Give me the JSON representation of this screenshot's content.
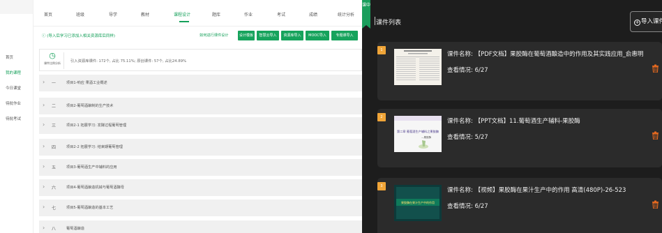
{
  "sidebar": {
    "items": [
      "首页",
      "我的课程",
      "今日课堂",
      "待批作业",
      "待批考试"
    ],
    "active_index": 1
  },
  "nav": {
    "items": [
      "首页",
      "班级",
      "导学",
      "教材",
      "课程设计",
      "题库",
      "作业",
      "考试",
      "成绩",
      "统计分析"
    ],
    "active_index": 4
  },
  "notice": "(导入后学习已添加入相关资源库后同样)",
  "notice_link": "如何进行课件设计",
  "toolbar": {
    "buttons": [
      "设计模板",
      "智慧云导入",
      "资源库导入",
      "MOOC导入",
      "专题课导入"
    ]
  },
  "stats": {
    "icon": "clock-icon",
    "icon_label": "课件比例分析",
    "text": "引入资源库课件: 172个, 占比 75.11%; 原创课件: 57个, 占比24.89%"
  },
  "modules": [
    {
      "num": "一",
      "title": "项目1-响应 果酒工业概述"
    },
    {
      "num": "二",
      "title": "项目2-葡萄酒酿制的生产技术"
    },
    {
      "num": "三",
      "title": "项目2-1 拓展学习: 发酵过程葡萄管理"
    },
    {
      "num": "四",
      "title": "项目2-2 拓展学习: 结束期葡萄管理"
    },
    {
      "num": "五",
      "title": "项目3-葡萄酒生产中辅料的应用"
    },
    {
      "num": "六",
      "title": "项目4-葡萄酒酿造机械与葡萄酒酵母"
    },
    {
      "num": "七",
      "title": "项目5-葡萄酒酿造的基本工艺"
    },
    {
      "num": "八",
      "title": "葡萄酒酿造"
    }
  ],
  "panel": {
    "tab_label": "课中",
    "title": "课件列表",
    "import_label": "导入课件"
  },
  "courseware": [
    {
      "index": "1",
      "name": "课件名称: 【PDF文档】果胶酶在葡萄酒酿造中的作用及其实践应用_俞惠明",
      "views": "查看情况: 6/27"
    },
    {
      "index": "2",
      "name": "课件名称: 【PPT文档】11.葡萄酒生产辅料-果胶酶",
      "views": "查看情况: 5/27",
      "thumb_title": "第二章 葡萄酒生产辅料之果胶酶",
      "thumb_sub": "—果胶酶"
    },
    {
      "index": "3",
      "name": "课件名称: 【视频】果胶酶在果汁生产中的作用 高清(480P)-26-523",
      "views": "查看情况: 6/27",
      "thumb_title": "果胶酶在果汁生产中的作用"
    }
  ],
  "colors": {
    "brand_green": "#16a35c",
    "badge_orange": "#f0a538",
    "trash_orange": "#e86a1f",
    "dark_bg": "#1d1d1d",
    "card_bg": "#2b2b2b"
  }
}
